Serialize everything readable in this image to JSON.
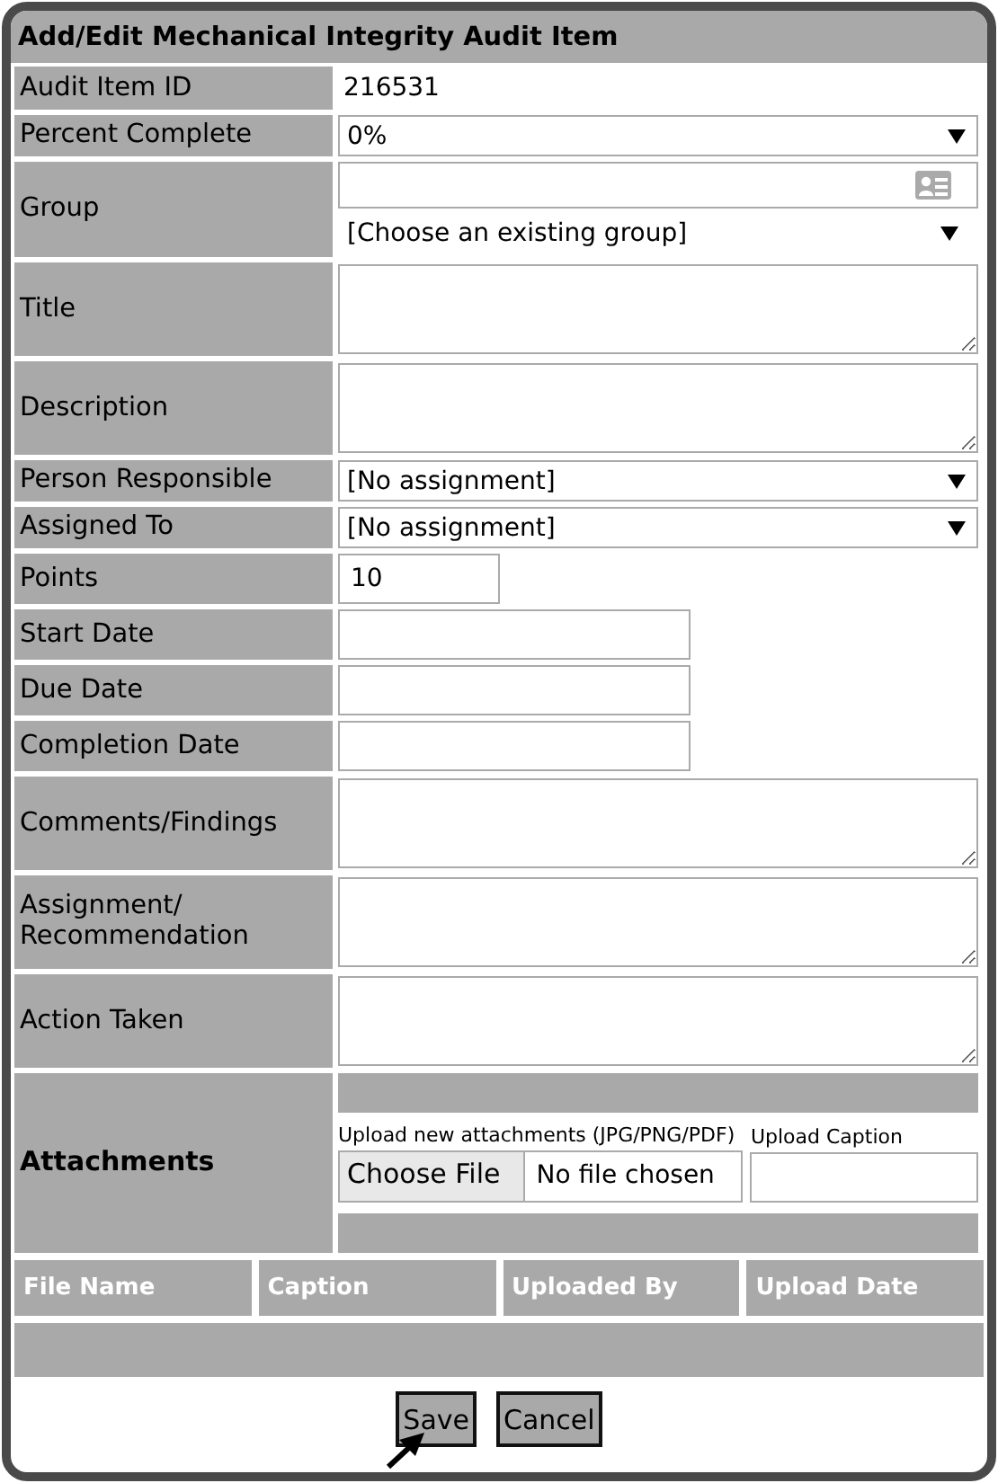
{
  "window": {
    "title": "Add/Edit Mechanical Integrity Audit Item"
  },
  "fields": [
    {
      "label": "Audit Item ID",
      "kind": "static",
      "value": "216531"
    },
    {
      "label": "Percent Complete",
      "kind": "select",
      "value": "0%"
    },
    {
      "label": "Group",
      "kind": "group",
      "value": "[Choose an existing group]"
    },
    {
      "label": "Title",
      "kind": "textarea"
    },
    {
      "label": "Description",
      "kind": "textarea"
    },
    {
      "label": "Person Responsible",
      "kind": "select",
      "value": "[No assignment]"
    },
    {
      "label": "Assigned To",
      "kind": "select",
      "value": "[No assignment]"
    },
    {
      "label": "Points",
      "kind": "number",
      "value": "10"
    },
    {
      "label": "Start Date",
      "kind": "date"
    },
    {
      "label": "Due Date",
      "kind": "date"
    },
    {
      "label": "Completion Date",
      "kind": "date"
    },
    {
      "label": "Comments/Findings",
      "kind": "textarea"
    },
    {
      "label": "Assignment/\nRecommendation",
      "kind": "textarea"
    },
    {
      "label": "Action Taken",
      "kind": "textarea"
    }
  ],
  "attachments": {
    "label": "Attachments",
    "upload_label": "Upload new attachments (JPG/PNG/PDF)",
    "choose_button": "Choose File",
    "file_status": "No file chosen",
    "caption_label": "Upload Caption"
  },
  "files_table": {
    "columns": [
      "File Name",
      "Caption",
      "Uploaded By",
      "Upload Date"
    ]
  },
  "buttons": [
    "Save",
    "Cancel"
  ]
}
